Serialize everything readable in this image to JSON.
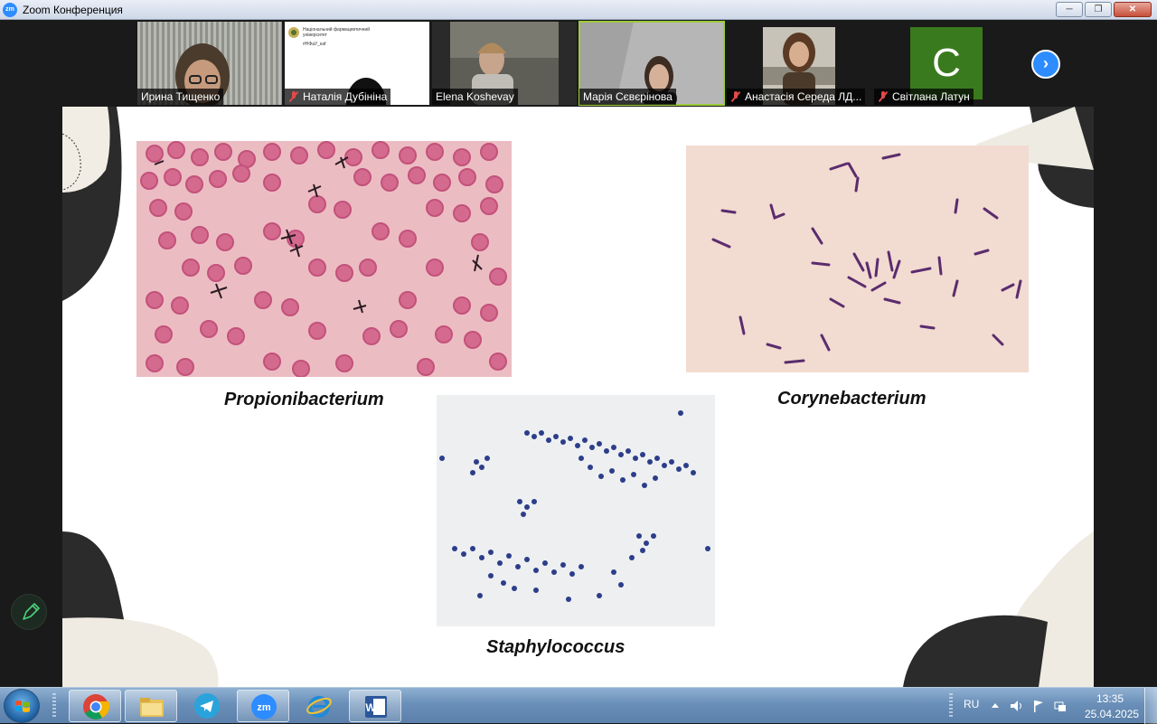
{
  "window": {
    "title": "Zoom Конференция",
    "app_icon_text": "zm",
    "controls": {
      "minimize": "─",
      "restore": "❐",
      "close": "✕"
    }
  },
  "participants": [
    {
      "name": "Ирина Тищенко",
      "muted": false
    },
    {
      "name": "Наталія Дубініна",
      "muted": true
    },
    {
      "name": "Elena Koshevay",
      "muted": false
    },
    {
      "name": "Марія Сєвєрінова",
      "muted": false,
      "active_speaker": true
    },
    {
      "name": "Анастасія Середа ЛД...",
      "muted": true
    },
    {
      "name": "Світлана Латун",
      "muted": true,
      "avatar_letter": "C",
      "avatar_color": "#3a7a1e"
    }
  ],
  "shared_slide_preview": {
    "line1": "Національний фармацевтичний",
    "line2": "університет",
    "line3": "#НФаУ_каf"
  },
  "next_button": "›",
  "slide": {
    "captions": {
      "left": "Propionibacterium",
      "right": "Corynebacterium",
      "bottom": "Staphylococcus"
    }
  },
  "annotate_icon": "pencil-icon",
  "taskbar": {
    "apps": [
      "Chrome",
      "Explorer",
      "Telegram",
      "Zoom",
      "Internet Explorer",
      "Word"
    ],
    "language": "RU",
    "time": "13:35",
    "date": "25.04.2025"
  },
  "colors": {
    "zoom_blue": "#2d8cff",
    "active_speaker_border": "#9ecb3c",
    "muted_red": "#e24a4a"
  }
}
